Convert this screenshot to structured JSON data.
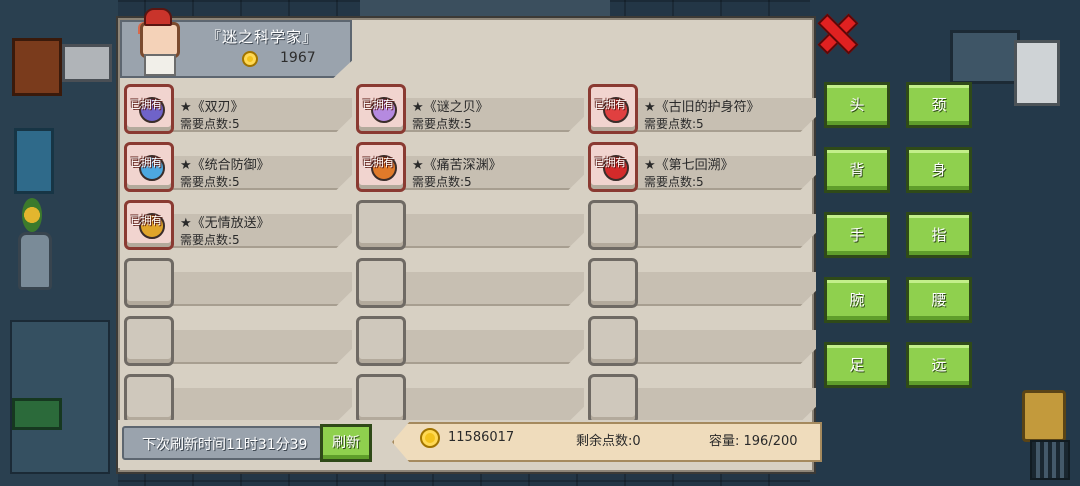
{
  "header": {
    "title": "『迷之科学家』",
    "coins": "1967"
  },
  "owned_tag": "已拥有",
  "items": [
    {
      "name": "★《双刃》",
      "cost": "需要点数:5",
      "owned": true,
      "gem_color": "#6f63c9"
    },
    {
      "name": "★《谜之贝》",
      "cost": "需要点数:5",
      "owned": true,
      "gem_color": "#b58ae0"
    },
    {
      "name": "★《古旧的护身符》",
      "cost": "需要点数:5",
      "owned": true,
      "gem_color": "#e04040"
    },
    {
      "name": "★《统合防御》",
      "cost": "需要点数:5",
      "owned": true,
      "gem_color": "#4da8e0"
    },
    {
      "name": "★《痛苦深渊》",
      "cost": "需要点数:5",
      "owned": true,
      "gem_color": "#e07a2a"
    },
    {
      "name": "★《第七回溯》",
      "cost": "需要点数:5",
      "owned": true,
      "gem_color": "#d42a2a"
    },
    {
      "name": "★《无情放送》",
      "cost": "需要点数:5",
      "owned": true,
      "gem_color": "#e0a52a"
    }
  ],
  "empty_slots": 11,
  "side_buttons": [
    "头",
    "颈",
    "背",
    "身",
    "手",
    "指",
    "腕",
    "腰",
    "足",
    "远"
  ],
  "bottom": {
    "refresh_time": "下次刷新时间11时31分39",
    "refresh_button": "刷新",
    "coins": "11586017",
    "remaining_points": "剩余点数:0",
    "capacity": "容量: 196/200"
  }
}
